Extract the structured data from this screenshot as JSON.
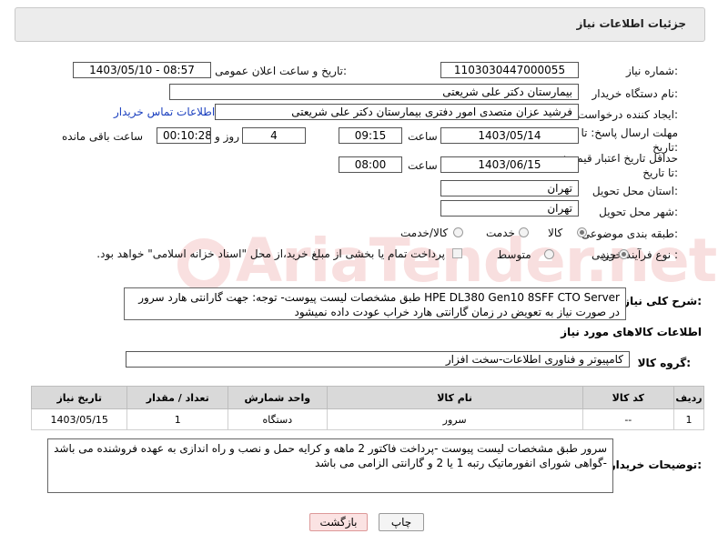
{
  "header": {
    "title": "جزئیات اطلاعات نیاز"
  },
  "form": {
    "need_number_label": "شماره نیاز:",
    "need_number": "1103030447000055",
    "announce_label": "تاریخ و ساعت اعلان عمومی:",
    "announce_value": "1403/05/10 - 08:57",
    "buyer_org_label": "نام دستگاه خریدار:",
    "buyer_org": "بیمارستان دکتر علی شریعتی",
    "creator_label": "ایجاد کننده درخواست:",
    "creator": "فرشید  عزان متصدی امور دفتری بیمارستان دکتر علی شریعتی",
    "contact_link": "اطلاعات تماس خریدار",
    "reply_deadline_label": "مهلت ارسال پاسخ: تا تاریخ:",
    "reply_date": "1403/05/14",
    "time_label": "ساعت",
    "reply_time": "09:15",
    "days_value": "4",
    "days_label": "روز و",
    "remaining_time": "00:10:28",
    "remaining_label": "ساعت باقی مانده",
    "price_validity_label": "حداقل تاریخ اعتبار قیمت: تا تاریخ:",
    "price_date": "1403/06/15",
    "price_time": "08:00",
    "province_label": "استان محل تحویل:",
    "province": "تهران",
    "city_label": "شهر محل تحویل:",
    "city": "تهران",
    "category_label": "طبقه بندی موضوعی:",
    "category_options": [
      "کالا",
      "خدمت",
      "کالا/خدمت"
    ],
    "process_label": "نوع فرآیند خرید :",
    "process_options": [
      "جزیی",
      "متوسط"
    ],
    "payment_note": "پرداخت تمام یا بخشی از مبلغ خرید،از محل \"اسناد خزانه اسلامی\" خواهد بود."
  },
  "description": {
    "label": "شرح کلی نیاز:",
    "text": "HPE DL380 Gen10 8SFF CTO Server طبق مشخصات لیست پیوست- توجه: جهت گارانتی هارد سرور  در صورت نیاز به تعویض در زمان گارانتی هارد خراب عودت داده نمیشود"
  },
  "goods": {
    "section_title": "اطلاعات کالاهای مورد نیاز",
    "group_label": "گروه کالا:",
    "group_value": "کامپیوتر و فناوری اطلاعات-سخت افزار",
    "columns": [
      "ردیف",
      "کد کالا",
      "نام کالا",
      "واحد شمارش",
      "تعداد / مقدار",
      "تاریخ نیاز"
    ],
    "rows": [
      [
        "1",
        "--",
        "سرور",
        "دستگاه",
        "1",
        "1403/05/15"
      ]
    ]
  },
  "buyer_notes": {
    "label": "توضیحات خریدار:",
    "text": "سرور طبق مشخصات لیست پیوست -پرداخت فاکتور 2 ماهه و کرایه حمل و نصب و راه اندازی به عهده فروشنده می باشد -گواهی شورای انفورماتیک رتبه 1 یا 2 و گارانتی الزامی می باشد"
  },
  "buttons": {
    "print": "چاپ",
    "back": "بازگشت"
  },
  "watermark": {
    "text": "AriaTender.net"
  }
}
